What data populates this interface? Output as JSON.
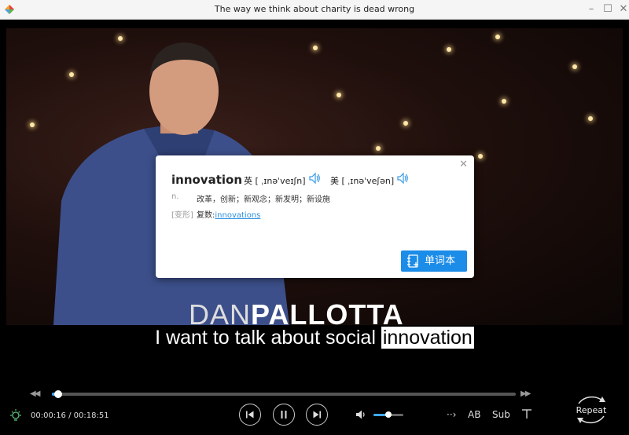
{
  "window": {
    "title": "The way we think about charity is dead wrong"
  },
  "video": {
    "lower_third_first": "DAN",
    "lower_third_last": "PALLOTTA"
  },
  "subtitle": {
    "before": "I want to talk about social ",
    "highlighted_word": "innovation"
  },
  "dictionary_popup": {
    "word": "innovation",
    "uk_phonetic": "英 [ ˌɪnəˈveɪʃn]",
    "us_phonetic": "美 [ ˌɪnəˈveʃən]",
    "part_of_speech": "n.",
    "definitions": "改革，创新；新观念；新发明；新设施",
    "inflection_tag": "[变形]",
    "inflection_prefix": "复数:",
    "inflection_word": "innovations",
    "vocab_button_label": "单词本",
    "close_icon": "close-icon",
    "speaker_icon": "speaker-icon"
  },
  "controls": {
    "current_time": "00:00:16",
    "total_time": "00:18:51",
    "time_separator": " / ",
    "progress_fraction": 0.014,
    "volume_fraction": 0.5,
    "ab_label": "AB",
    "sub_label": "Sub",
    "repeat_label": "Repeat",
    "accent_color": "#3ea8ff"
  }
}
